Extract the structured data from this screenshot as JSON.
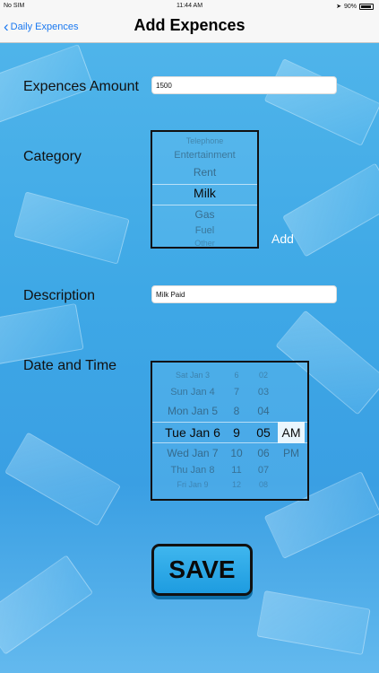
{
  "status": {
    "carrier": "No SIM",
    "time": "11:44 AM",
    "battery": "90%"
  },
  "nav": {
    "back_label": "Daily Expences",
    "title": "Add Expences"
  },
  "form": {
    "amount_label": "Expences Amount",
    "amount_value": "1500",
    "category_label": "Category",
    "category_options": [
      "Telephone",
      "Entertainment",
      "Rent",
      "Milk",
      "Gas",
      "Fuel",
      "Other"
    ],
    "category_selected": "Milk",
    "add_label": "Add",
    "description_label": "Description",
    "description_value": "Milk Paid",
    "datetime_label": "Date and Time",
    "date_options": [
      "Sat Jan 3",
      "Sun Jan 4",
      "Mon Jan 5",
      "Tue Jan 6",
      "Wed Jan 7",
      "Thu Jan 8",
      "Fri Jan 9"
    ],
    "hour_options": [
      "6",
      "7",
      "8",
      "9",
      "10",
      "11",
      "12"
    ],
    "minute_options": [
      "02",
      "03",
      "04",
      "05",
      "06",
      "07",
      "08"
    ],
    "ampm_options": [
      "AM",
      "PM"
    ],
    "save_label": "SAVE"
  },
  "colors": {
    "accent": "#1a78f0",
    "background": "#3ea8e6"
  }
}
